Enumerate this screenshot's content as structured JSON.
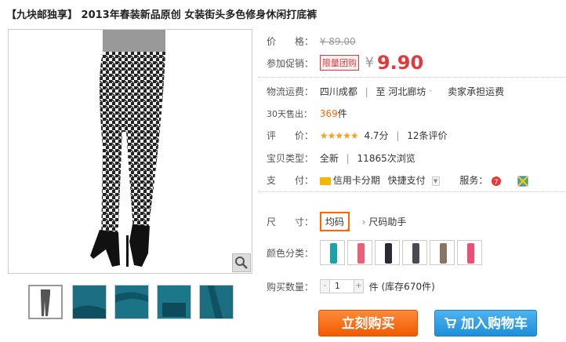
{
  "title": "【九块邮独享】 2013年春装新品原创 女装街头多色修身休闲打底裤",
  "price": {
    "label": "价　　格：",
    "original": "¥ 89.00"
  },
  "promo": {
    "label": "参加促销：",
    "badge": "限量团购",
    "currency": "¥",
    "price": "9.90"
  },
  "shipping": {
    "label": "物流运费：",
    "from": "四川成都",
    "sep": "|",
    "to_prefix": "至",
    "to": "河北廊坊",
    "note": "卖家承担运费"
  },
  "sales": {
    "label": "30天售出：",
    "count": "369",
    "unit": "件"
  },
  "rating": {
    "label": "评　　价：",
    "stars": "★★★★★",
    "score": "4.7分",
    "sep": "|",
    "reviews": "12条评价"
  },
  "type": {
    "label": "宝贝类型：",
    "condition": "全新",
    "sep": "|",
    "views": "11865次浏览"
  },
  "payment": {
    "label": "支　　付：",
    "installment": "信用卡分期",
    "express": "快捷支付",
    "service_label": "服务："
  },
  "size": {
    "label": "尺　　寸：",
    "selected": "均码",
    "helper": "尺码助手"
  },
  "color": {
    "label": "颜色分类：",
    "swatches": [
      "#1aa3a8",
      "#e8607a",
      "#2a2a33",
      "#4a4a55",
      "#8a7468",
      "#e8507a"
    ]
  },
  "quantity": {
    "label": "购买数量：",
    "value": "1",
    "unit": "件",
    "stock": "(库存670件)"
  },
  "buttons": {
    "buy_now": "立刻购买",
    "add_cart": "加入购物车"
  },
  "icons": {
    "zoom": "magnifier-icon",
    "card": "credit-card-icon",
    "cart": "cart-icon"
  }
}
